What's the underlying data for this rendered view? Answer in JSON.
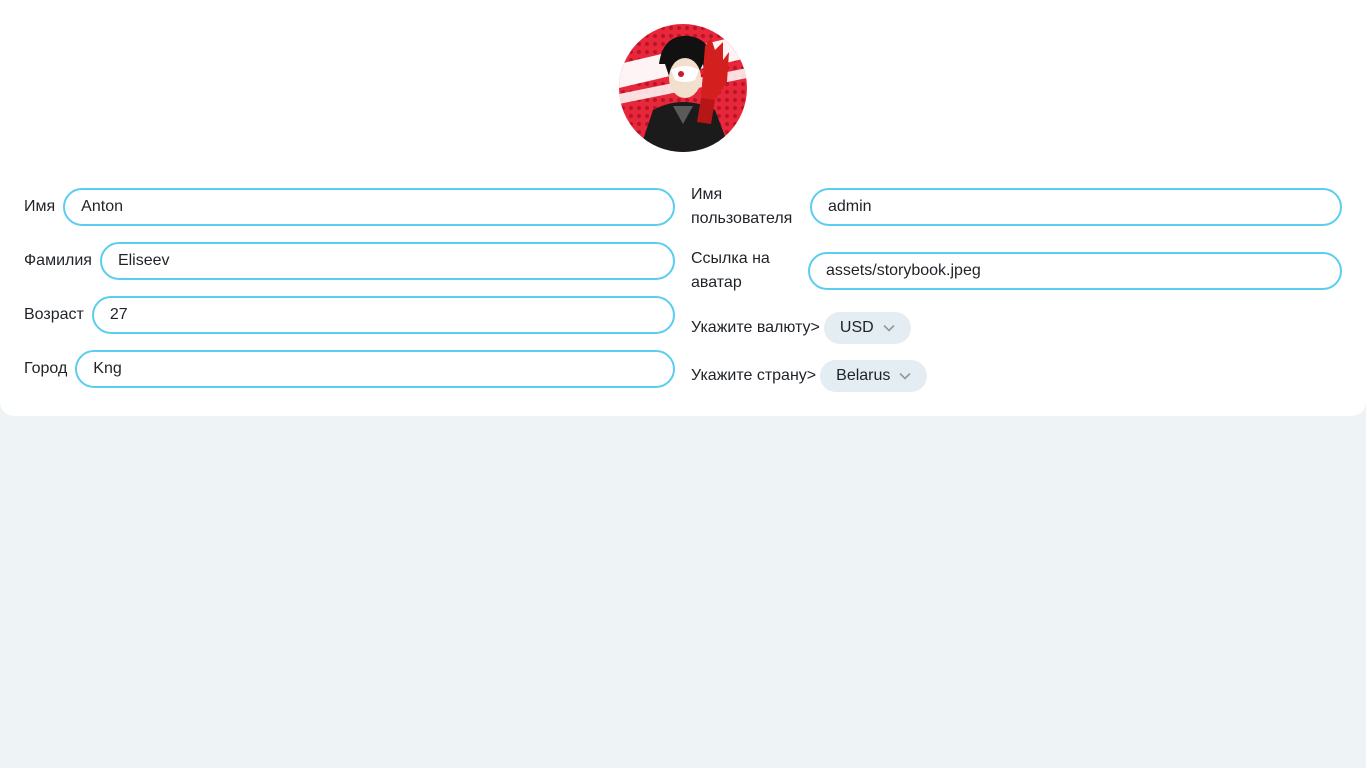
{
  "profile": {
    "avatar_icon": "persona-character-avatar",
    "colors": {
      "accent": "#5bcdf0",
      "select_bg": "#e4edf2",
      "background": "#eef3f6"
    },
    "left": {
      "first_name": {
        "label": "Имя",
        "value": "Anton"
      },
      "last_name": {
        "label": "Фамилия",
        "value": "Eliseev"
      },
      "age": {
        "label": "Возраст",
        "value": "27"
      },
      "city": {
        "label": "Город",
        "value": "Kng"
      }
    },
    "right": {
      "username": {
        "label": "Имя пользователя",
        "value": "admin"
      },
      "avatar_link": {
        "label": "Ссылка на аватар",
        "value": "assets/storybook.jpeg"
      },
      "currency": {
        "label": "Укажите валюту>",
        "value": "USD"
      },
      "country": {
        "label": "Укажите страну>",
        "value": "Belarus"
      }
    }
  }
}
